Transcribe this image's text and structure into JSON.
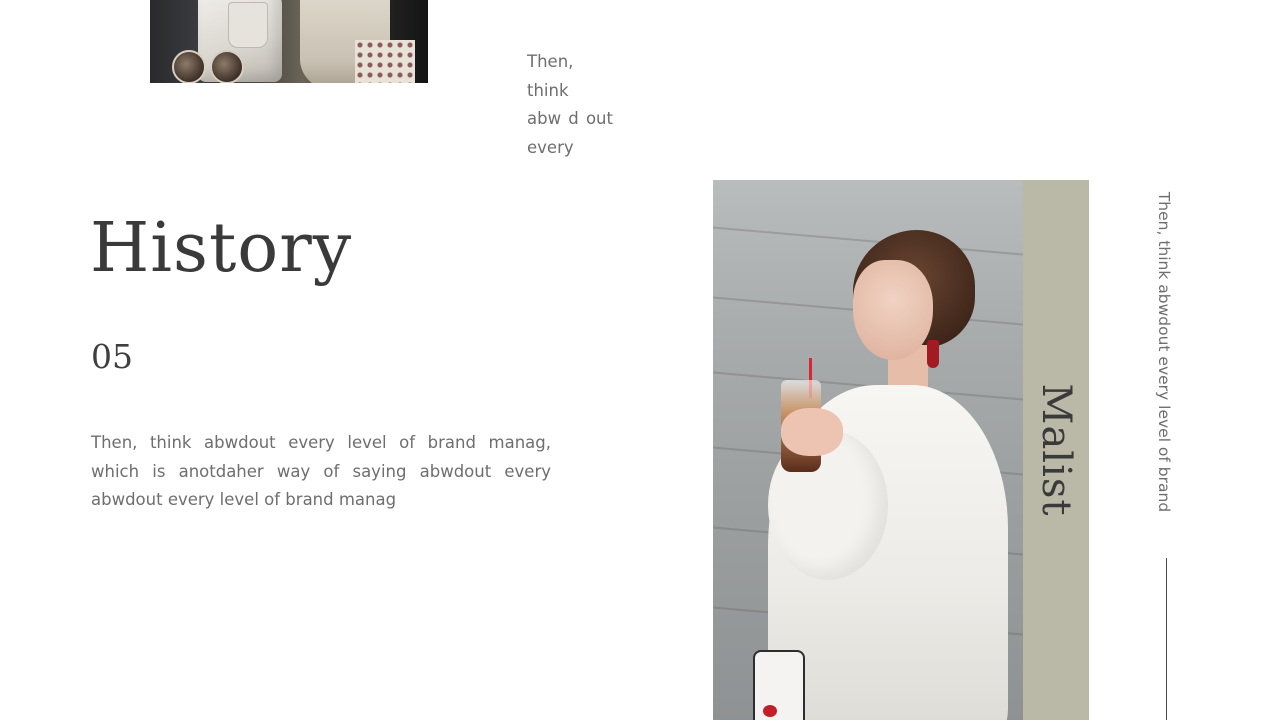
{
  "slide": {
    "heading": "History",
    "number": "05",
    "body_text": "Then, think abwdout every level of brand manag, which is anotdaher way of saying abwdout every abwdout every level of brand manag",
    "top_text_lines": [
      "Then, think",
      "abw d out",
      "every"
    ],
    "side_label": "Malist",
    "vertical_text": "Then, think abwdout every level of brand"
  },
  "colors": {
    "background": "#ffffff",
    "side_panel": "#bab8a7",
    "heading": "#3a3a3a",
    "body_text": "#6e6e6e",
    "rule": "#4a4a4a"
  }
}
